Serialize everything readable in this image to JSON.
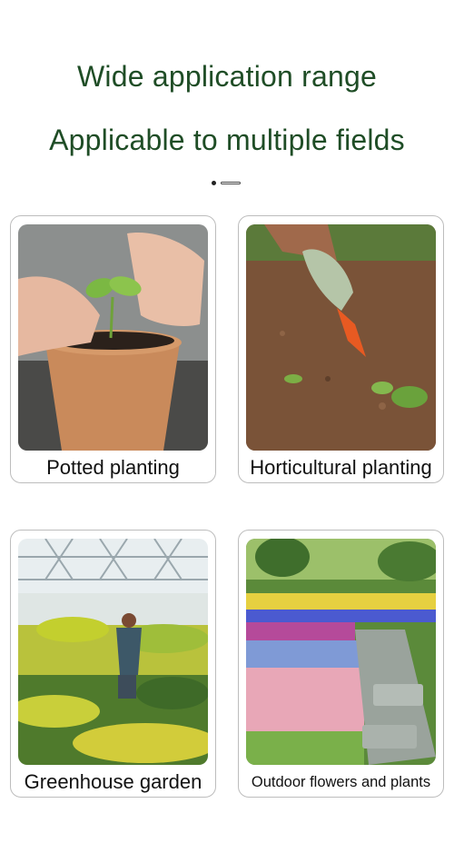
{
  "header": {
    "title": "Wide application range",
    "subtitle": "Applicable to multiple fields"
  },
  "carousel": {
    "active_index": 0,
    "count": 2
  },
  "cards": [
    {
      "caption": "Potted planting",
      "image": "potted-seedling-photo"
    },
    {
      "caption": "Horticultural planting",
      "image": "garden-trowel-soil-photo"
    },
    {
      "caption": "Greenhouse garden",
      "image": "greenhouse-gardener-photo"
    },
    {
      "caption": "Outdoor flowers and plants",
      "image": "flower-garden-path-photo"
    }
  ],
  "colors": {
    "title": "#1f4d26",
    "card_border": "#bdbdbd",
    "caption": "#111111"
  }
}
